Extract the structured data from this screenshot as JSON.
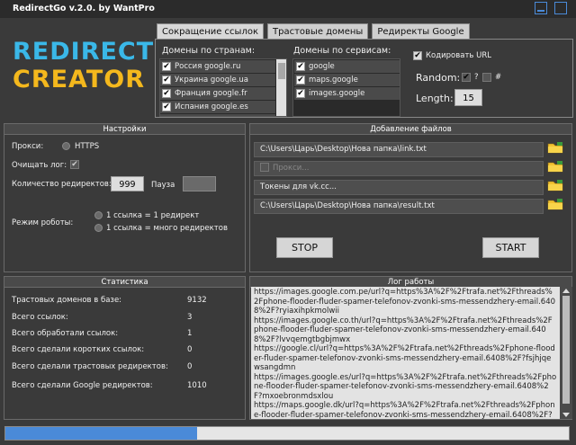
{
  "window": {
    "title": "RedirectGo v.2.0. by WantPro"
  },
  "logo": {
    "line1": "REDIRECT",
    "line2": "CREATOR"
  },
  "tabs": [
    {
      "label": "Сокращение ссылок"
    },
    {
      "label": "Трастовые домены"
    },
    {
      "label": "Редиректы Google"
    }
  ],
  "domains": {
    "countries_label": "Домены по странам:",
    "countries": [
      {
        "label": "Россия google.ru",
        "checked": true
      },
      {
        "label": "Украина google.ua",
        "checked": true
      },
      {
        "label": "Франция google.fr",
        "checked": true
      },
      {
        "label": "Испания google.es",
        "checked": true
      },
      {
        "label": "",
        "checked": true
      }
    ],
    "services_label": "Домены по сервисам:",
    "services": [
      {
        "label": "google",
        "checked": true
      },
      {
        "label": "maps.google",
        "checked": true
      },
      {
        "label": "images.google",
        "checked": true
      }
    ],
    "encode_url_label": "Кодировать URL",
    "random_label": "Random:",
    "random_q": "?",
    "random_hash": "#",
    "length_label": "Length:",
    "length_value": "15"
  },
  "settings": {
    "header": "Настройки",
    "proxy_label": "Прокси:",
    "proxy_option": "HTTPS",
    "clear_log_label": "Очищать лог:",
    "redirect_count_label": "Количество редиректов:",
    "redirect_count_value": "999",
    "pause_label": "Пауза",
    "pause_value": "",
    "mode_label": "Режим роботы:",
    "mode_option1": "1 ссылка = 1 редирект",
    "mode_option2": "1 ссылка = много редиректов"
  },
  "files": {
    "header": "Добавление файлов",
    "link_path": "C:\\Users\\Царь\\Desktop\\Нова папка\\link.txt",
    "proxy_placeholder": "Прокси...",
    "tokens_placeholder": "Токены для vk.cc...",
    "result_path": "C:\\Users\\Царь\\Desktop\\Нова папка\\result.txt",
    "stop_label": "STOP",
    "start_label": "START"
  },
  "stats": {
    "header": "Статистика",
    "rows": [
      {
        "label": "Трастовых доменов в базе:",
        "value": "9132"
      },
      {
        "label": "Всего ссылок:",
        "value": "3"
      },
      {
        "label": "Всего обработали ссылок:",
        "value": "1"
      },
      {
        "label": "Всего сделали коротких ссылок:",
        "value": "0"
      },
      {
        "label": "Всего сделали трастовых редиректов:",
        "value": "0"
      },
      {
        "label": "Всего сделали Google редиректов:",
        "value": "1010"
      }
    ]
  },
  "log": {
    "header": "Лог работы",
    "text": "https://images.google.com.pe/url?q=https%3A%2F%2Ftrafa.net%2Fthreads%2Fphone-flooder-fluder-spamer-telefonov-zvonki-sms-messendzhery-email.6408%2F?ryiaxihpkmolwii\nhttps://images.google.co.th/url?q=https%3A%2F%2Ftrafa.net%2Fthreads%2Fphone-flooder-fluder-spamer-telefonov-zvonki-sms-messendzhery-email.6408%2F?lvvqemgtbgbjmwx\nhttps://google.cl/url?q=https%3A%2F%2Ftrafa.net%2Fthreads%2Fphone-flooder-fluder-spamer-telefonov-zvonki-sms-messendzhery-email.6408%2F?fsjhjqewsangdmn\nhttps://images.google.es/url?q=https%3A%2F%2Ftrafa.net%2Fthreads%2Fphone-flooder-fluder-spamer-telefonov-zvonki-sms-messendzhery-email.6408%2F?mxoebronmdsxlou\nhttps://maps.google.dk/url?q=https%3A%2F%2Ftrafa.net%2Fthreads%2Fphone-flooder-fluder-spamer-telefonov-zvonki-sms-messendzhery-email.6408%2F?"
  },
  "progress": {
    "fraction": 0.34
  },
  "colors": {
    "accent_blue": "#4a8ad8",
    "logo_blue": "#3ab8e8",
    "logo_yellow": "#f4b81d"
  }
}
